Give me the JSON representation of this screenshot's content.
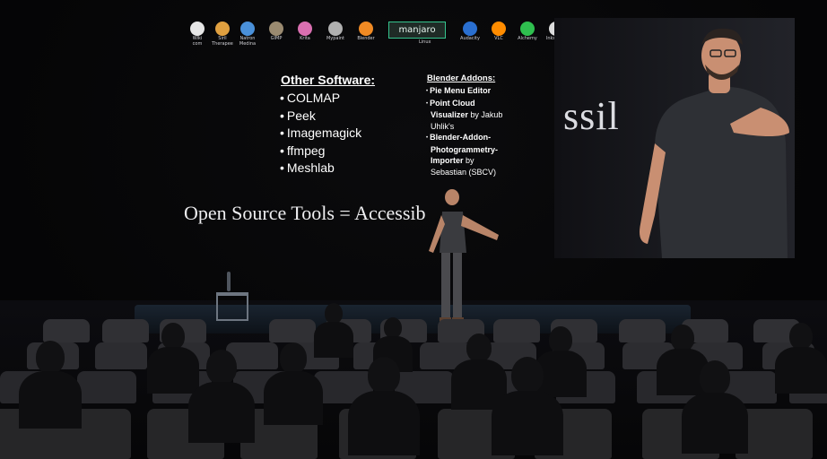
{
  "slide": {
    "logos": [
      {
        "icon": "wikimedia-icon",
        "caption": "Wiki\ncom",
        "color": "#e6e6e6"
      },
      {
        "icon": "siril-icon",
        "caption": "Siril\nTherapee",
        "color": "#e0a040"
      },
      {
        "icon": "natron-icon",
        "caption": "Natron\nMedina",
        "color": "#4a90d9"
      },
      {
        "icon": "gimp-icon",
        "caption": "GIMP",
        "color": "#9a8a70"
      },
      {
        "icon": "krita-icon",
        "caption": "Krita",
        "color": "#d96fb0"
      },
      {
        "icon": "mypaint-icon",
        "caption": "Mypaint",
        "color": "#b0b0b0"
      },
      {
        "icon": "blender-icon",
        "caption": "Blender",
        "color": "#f08a24"
      },
      {
        "icon": "audacity-icon",
        "caption": "Audacity",
        "color": "#2a6fd0"
      },
      {
        "icon": "vlc-icon",
        "caption": "VLC",
        "color": "#ff8c00"
      },
      {
        "icon": "alchemy-icon",
        "caption": "Alchemy",
        "color": "#2fbf4f"
      },
      {
        "icon": "inkscape-icon",
        "caption": "Inkscape",
        "color": "#dcdcdc"
      },
      {
        "icon": "obs-icon",
        "caption": "OBS",
        "color": "#c8c8c8"
      }
    ],
    "manjaro_label": "manjaro",
    "manjaro_caption": "Linux",
    "other_title": "Other Software:",
    "other_items": [
      "COLMAP",
      "Peek",
      "Imagemagick",
      "ffmpeg",
      "Meshlab"
    ],
    "addons_title": "Blender Addons:",
    "addons_lines": [
      {
        "pre": "•",
        "text": "Pie Menu Editor",
        "bold": true
      },
      {
        "pre": "•",
        "text": "Point Cloud",
        "bold": true
      },
      {
        "pre": "",
        "text": "Visualizer",
        "bold": true,
        "rest": " by Jakub"
      },
      {
        "pre": "",
        "text": "",
        "bold": false,
        "rest": "Uhlik's"
      },
      {
        "pre": "•",
        "text": "Blender-Addon-",
        "bold": true
      },
      {
        "pre": "",
        "text": "Photogrammetry-",
        "bold": true
      },
      {
        "pre": "",
        "text": "Importer",
        "bold": true,
        "rest": " by"
      },
      {
        "pre": "",
        "text": "",
        "bold": false,
        "rest": "Sebastian (SBCV)"
      }
    ],
    "tagline": "Open Source Tools = Accessib"
  },
  "screen": {
    "partial_text": "ssil"
  }
}
